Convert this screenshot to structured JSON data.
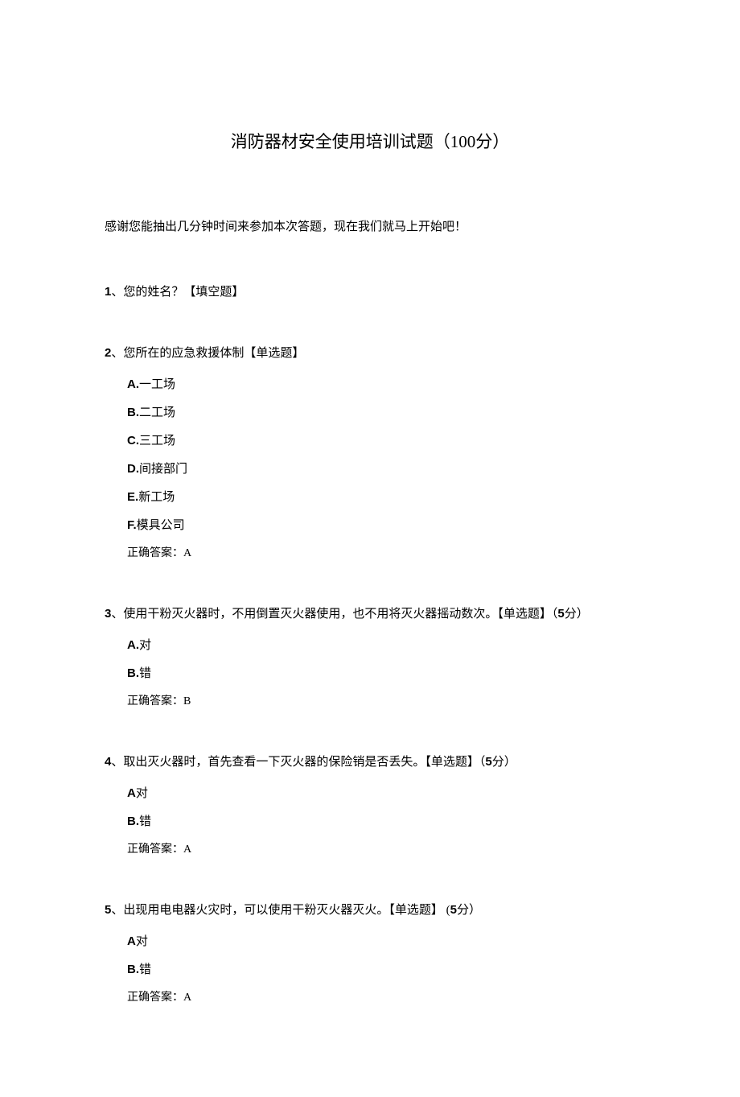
{
  "title": "消防器材安全使用培训试题（100分）",
  "intro": "感谢您能抽出几分钟时间来参加本次答题，现在我们就马上开始吧！",
  "q1": {
    "num": "1",
    "text": "、您的姓名？【填空题】"
  },
  "q2": {
    "num": "2",
    "text": "、您所在的应急救援体制【单选题】",
    "opts": {
      "a_letter": "A.",
      "a_text": "一工场",
      "b_letter": "B.",
      "b_text": "二工场",
      "c_letter": "C.",
      "c_text": "三工场",
      "d_letter": "D.",
      "d_text": "间接部门",
      "e_letter": "E.",
      "e_text": "新工场",
      "f_letter": "F.",
      "f_text": "模具公司"
    },
    "answer": "正确答案：A"
  },
  "q3": {
    "num": "3",
    "text": "、使用干粉灭火器时，不用倒置灭火器使用，也不用将灭火器摇动数次。【单选题】（",
    "pts": "5",
    "suffix": "分）",
    "opts": {
      "a_letter": "A.",
      "a_text": "对",
      "b_letter": "B.",
      "b_text": "错"
    },
    "answer": "正确答案：B"
  },
  "q4": {
    "num": "4",
    "text": "、取出灭火器时，首先查看一下灭火器的保险销是否丢失。【单选题】（",
    "pts": "5",
    "suffix": "分）",
    "opts": {
      "a_letter": "A",
      "a_text": "对",
      "b_letter": "B.",
      "b_text": "错"
    },
    "answer": "正确答案：A"
  },
  "q5": {
    "num": "5",
    "text": "、出现用电电器火灾时，可以使用干粉灭火器灭火。【单选题】 (",
    "pts": "5",
    "suffix": "分）",
    "opts": {
      "a_letter": "A",
      "a_text": "对",
      "b_letter": "B.",
      "b_text": "错"
    },
    "answer": "正确答案：A"
  }
}
